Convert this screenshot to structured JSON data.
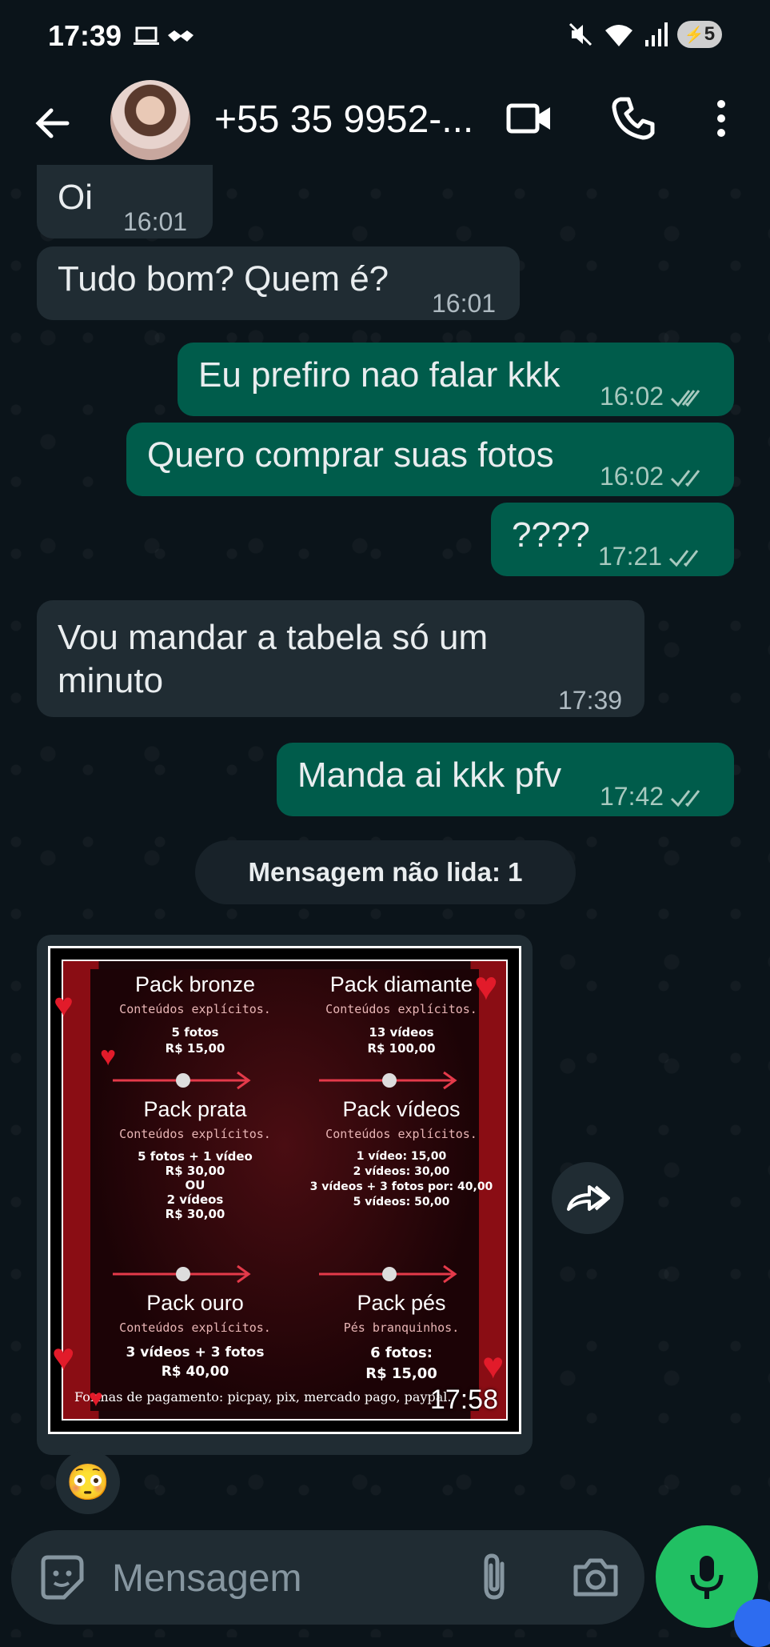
{
  "status_bar": {
    "time": "17:39",
    "battery": "5"
  },
  "header": {
    "contact_name": "+55 35 9952-..."
  },
  "messages": [
    {
      "dir": "in",
      "text": "Oi",
      "time": "16:01"
    },
    {
      "dir": "in",
      "text": "Tudo bom? Quem é?",
      "time": "16:01"
    },
    {
      "dir": "out",
      "text": "Eu prefiro nao falar kkk",
      "time": "16:02"
    },
    {
      "dir": "out",
      "text": "Quero comprar suas fotos",
      "time": "16:02"
    },
    {
      "dir": "out",
      "text": "????",
      "time": "17:21"
    },
    {
      "dir": "in",
      "text_line1": "Vou mandar a tabela só um",
      "text_line2": "minuto",
      "time": "17:39"
    },
    {
      "dir": "out",
      "text": "Manda ai kkk pfv",
      "time": "17:42"
    }
  ],
  "unread_label": "Mensagem não lida: 1",
  "image_message": {
    "time": "17:58",
    "packs": [
      {
        "title": "Pack bronze",
        "subtitle": "Conteúdos explícitos.",
        "lines": [
          "5 fotos",
          "R$ 15,00"
        ]
      },
      {
        "title": "Pack diamante",
        "subtitle": "Conteúdos explícitos.",
        "lines": [
          "13 vídeos",
          "R$ 100,00"
        ]
      },
      {
        "title": "Pack prata",
        "subtitle": "Conteúdos explícitos.",
        "lines": [
          "5 fotos + 1 vídeo",
          "R$ 30,00",
          "OU",
          "2 vídeos",
          "R$ 30,00"
        ]
      },
      {
        "title": "Pack vídeos",
        "subtitle": "Conteúdos explícitos.",
        "lines": [
          "1 vídeo: 15,00",
          "2 vídeos: 30,00",
          "3 vídeos + 3 fotos por: 40,00",
          "5 vídeos: 50,00"
        ]
      },
      {
        "title": "Pack ouro",
        "subtitle": "Conteúdos explícitos.",
        "lines": [
          "3 vídeos + 3 fotos",
          "R$ 40,00"
        ]
      },
      {
        "title": "Pack pés",
        "subtitle": "Pés branquinhos.",
        "lines": [
          "6 fotos:",
          "R$ 15,00"
        ]
      }
    ],
    "payment": "Formas de pagamento: picpay, pix, mercado pago, paypal."
  },
  "reaction_emoji": "😳",
  "input": {
    "placeholder": "Mensagem"
  },
  "colors": {
    "incoming": "#202c33",
    "outgoing": "#005c4b",
    "mic": "#21c063",
    "background": "#0b141a"
  }
}
